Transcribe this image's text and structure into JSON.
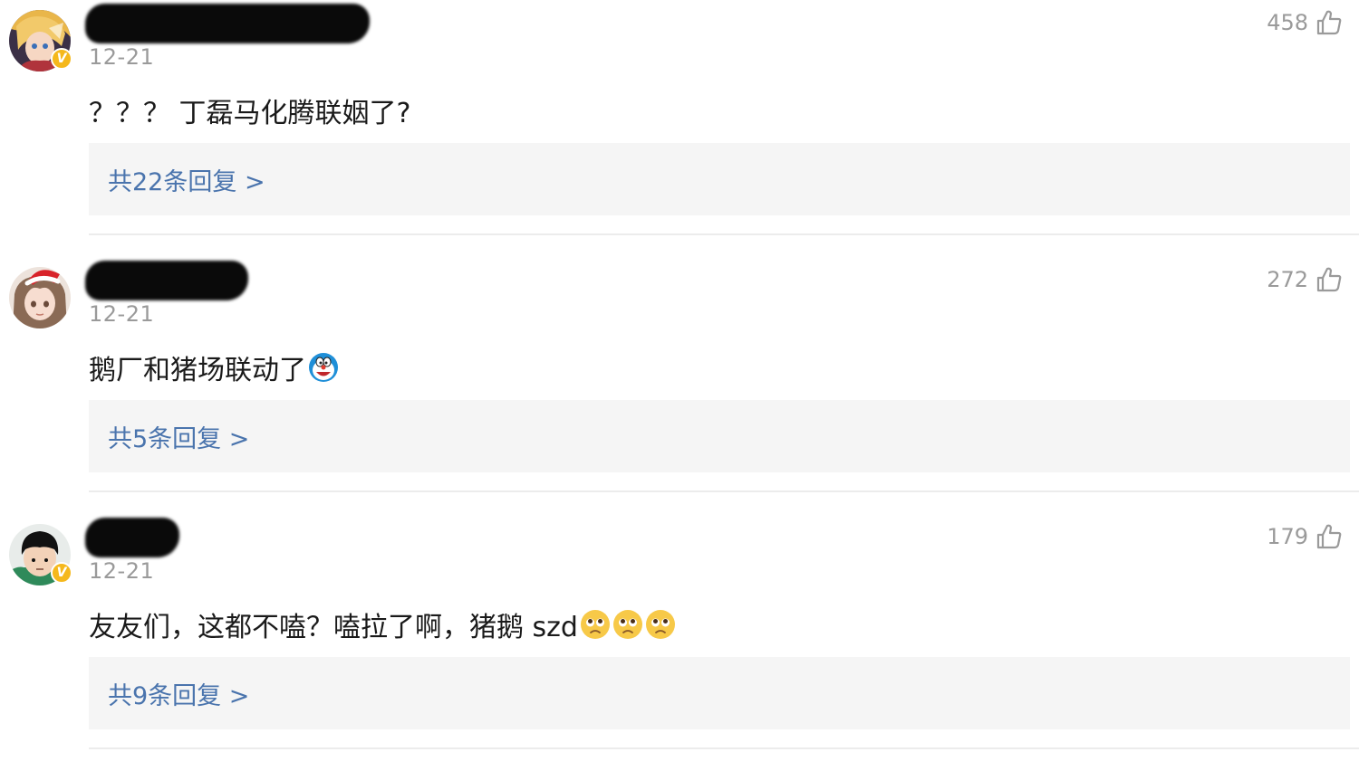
{
  "comments": [
    {
      "date": "12-21",
      "likes": "458",
      "verified_badge": "V",
      "text": "？？？ 丁磊马化腾联姻了?",
      "reply_link": "共22条回复 >",
      "emojis": []
    },
    {
      "date": "12-21",
      "likes": "272",
      "verified_badge": "",
      "text": "鹅厂和猪场联动了",
      "reply_link": "共5条回复 >",
      "emojis": [
        "doraemon-emoji"
      ]
    },
    {
      "date": "12-21",
      "likes": "179",
      "verified_badge": "V",
      "text": "友友们，这都不嗑？嗑拉了啊，猪鹅 szd",
      "reply_link": "共9条回复 >",
      "emojis": [
        "pleading-face-emoji",
        "pleading-face-emoji",
        "pleading-face-emoji"
      ]
    }
  ],
  "colors": {
    "reply_link": "#4a74ad",
    "meta_gray": "#9a9a9a",
    "reply_bg": "#f5f5f5",
    "verified_badge": "#f5b81c"
  }
}
